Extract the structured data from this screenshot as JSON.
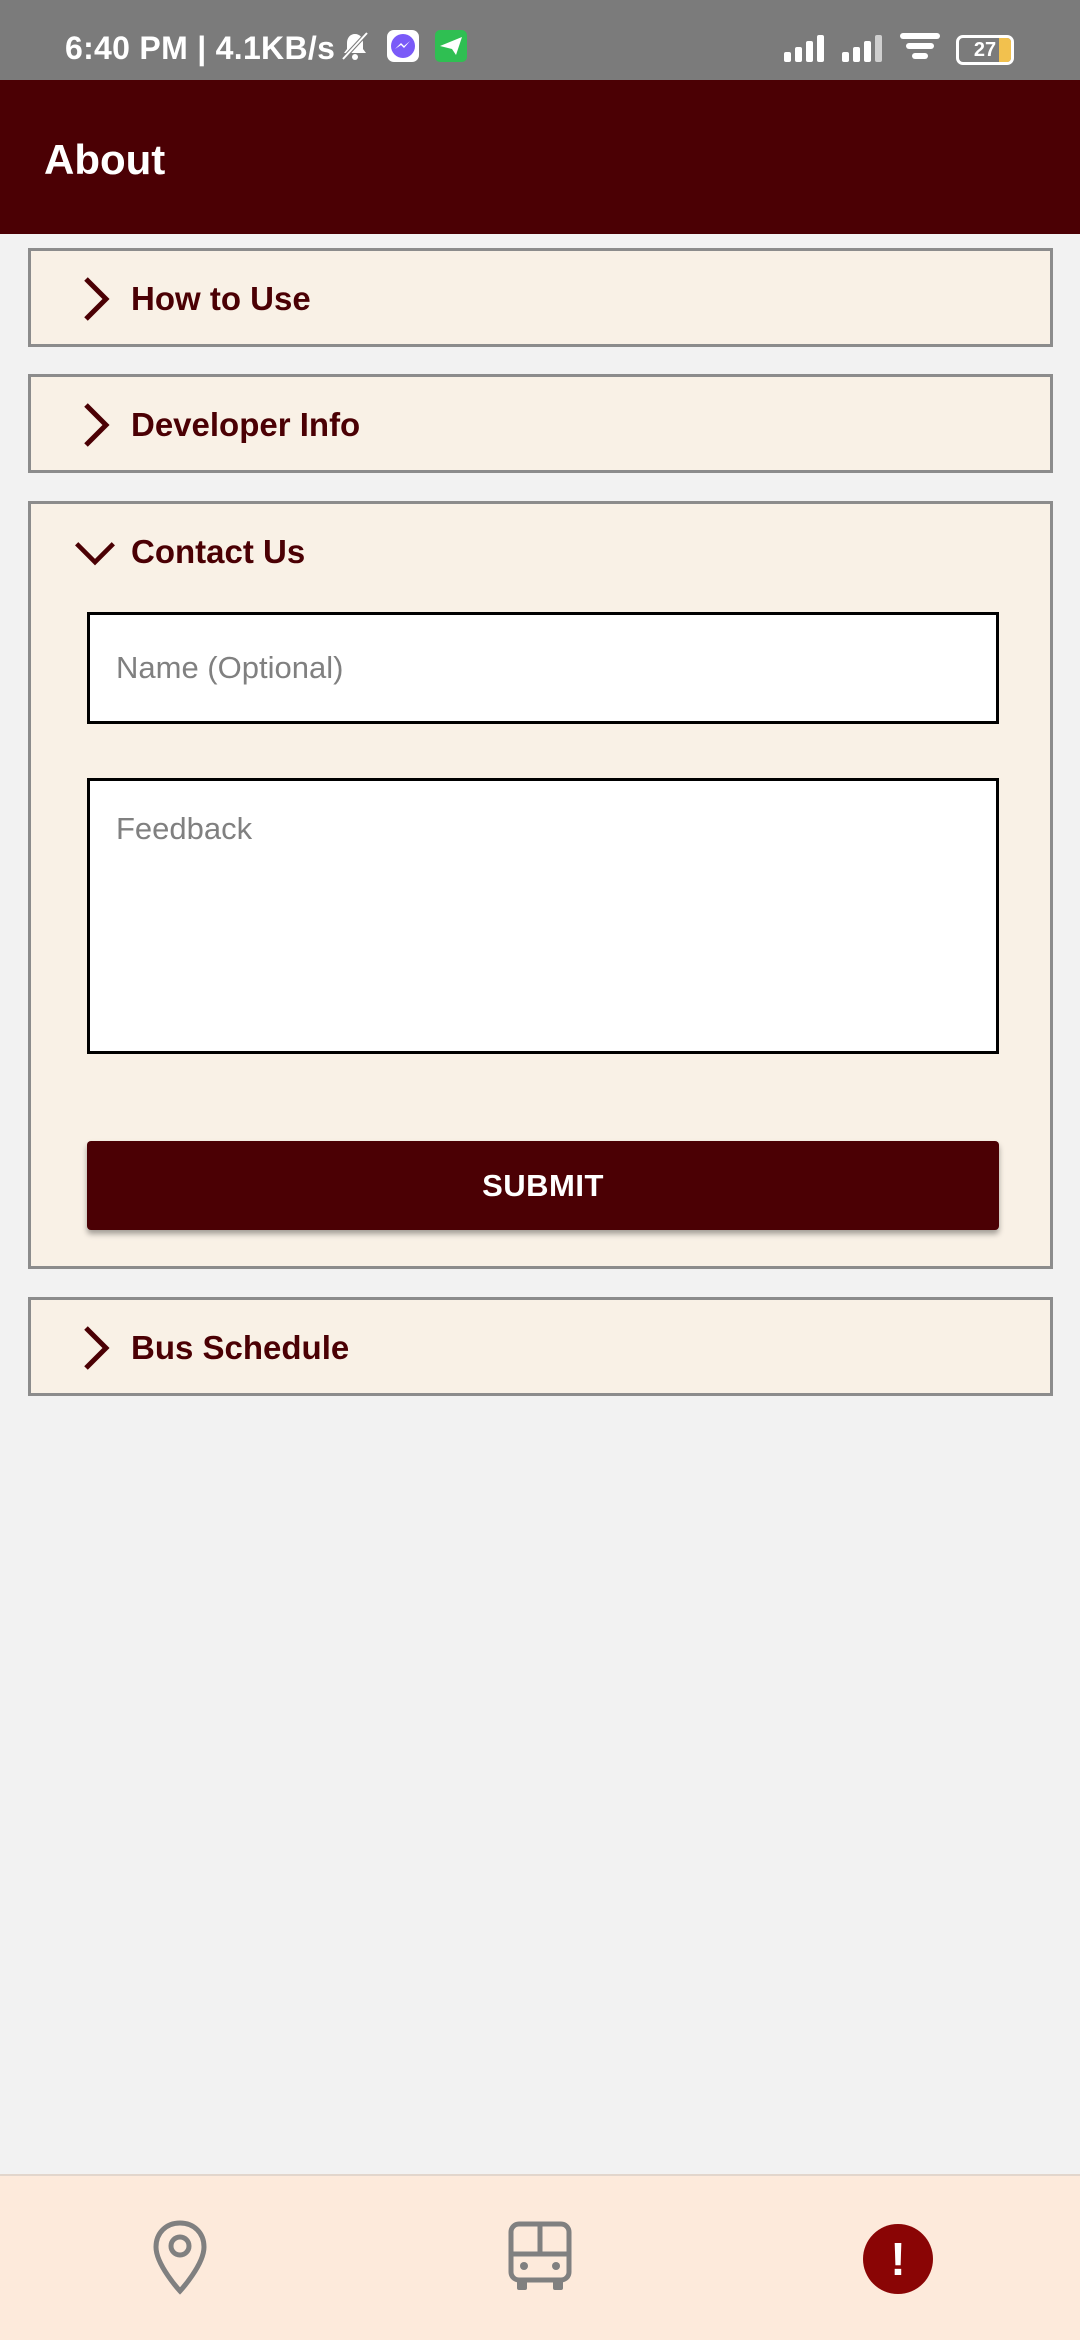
{
  "status_bar": {
    "time_speed": "6:40 PM | 4.1KB/s",
    "battery": "27"
  },
  "app_bar": {
    "title": "About"
  },
  "sections": [
    {
      "title": "How to Use",
      "expanded": false
    },
    {
      "title": "Developer Info",
      "expanded": false
    },
    {
      "title": "Contact Us",
      "expanded": true,
      "form": {
        "name_placeholder": "Name (Optional)",
        "name_value": "",
        "feedback_placeholder": "Feedback",
        "feedback_value": "",
        "submit_label": "SUBMIT"
      }
    },
    {
      "title": "Bus Schedule",
      "expanded": false
    }
  ],
  "bottom_nav": {
    "items": [
      {
        "icon": "map-pin-icon"
      },
      {
        "icon": "bus-icon"
      },
      {
        "icon": "alert-icon",
        "glyph": "!",
        "active": true
      }
    ]
  },
  "colors": {
    "primary": "#4b0004",
    "panel_bg": "#f9f1e6",
    "nav_bg": "#fdeadb",
    "alert": "#8a0505",
    "page_bg": "#f2f2f2"
  }
}
